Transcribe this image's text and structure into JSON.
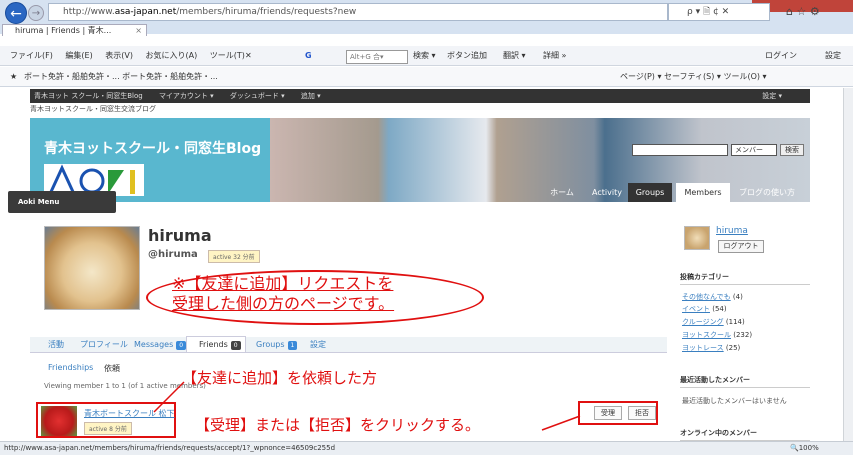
{
  "browser": {
    "url_prefix": "http://www.",
    "url_domain": "asa-japan.net",
    "url_path": "/members/hiruma/friends/requests?new",
    "addr_controls": "ρ ▾ 🗎 ¢ ✕",
    "tab_title": "hiruma | Friends | 青木...",
    "menu": [
      "ファイル(F)",
      "編集(E)",
      "表示(V)",
      "お気に入り(A)",
      "ツール(T)"
    ],
    "toolbar": {
      "google_placeholder": "Alt+G 合▾",
      "search": "検索 ▾",
      "button_add": "ボタン追加",
      "translate": "翻訳 ▾",
      "more": "詳細 »",
      "login": "ログイン",
      "settings": "設定"
    },
    "favorites": "ボート免許・船舶免許・...   ボート免許・船舶免許・...",
    "favbar_right": "ページ(P) ▾  セーフティ(S) ▾  ツール(O) ▾",
    "status_url": "http://www.asa-japan.net/members/hiruma/friends/requests/accept/1?_wpnonce=46509c255d",
    "zoom": "100%"
  },
  "site": {
    "adminbar": [
      "青木ヨット スクール・同窓生Blog",
      "マイアカウント ▾",
      "ダッシュボード ▾",
      "追加 ▾"
    ],
    "adminbar_right": "設定 ▾",
    "tagline": "青木ヨットスクール・同窓生交流ブログ",
    "title": "青木ヨットスクール・同窓生Blog",
    "search_select": "メンバー",
    "search_button": "検索",
    "nav": [
      "ホーム",
      "Activity",
      "Groups",
      "Members",
      "ブログの使い方"
    ],
    "aoki_menu": "Aoki Menu"
  },
  "profile": {
    "name": "hiruma",
    "handle": "@hiruma",
    "active": "active 32 分前",
    "callout": [
      "※【友達に追加】リクエストを",
      "受理した側の方のページです。"
    ],
    "tabs": [
      {
        "label": "活動",
        "count": null
      },
      {
        "label": "プロフィール",
        "count": null
      },
      {
        "label": "Messages",
        "count": "0"
      },
      {
        "label": "Friends",
        "count": "0"
      },
      {
        "label": "Groups",
        "count": "1"
      },
      {
        "label": "設定",
        "count": null
      }
    ],
    "sub_friendships": "Friendships",
    "sub_requests": "依頼",
    "viewing": "Viewing member 1 to 1 (of 1 active members)",
    "requester_label": "【友達に追加】を依頼した方",
    "request": {
      "name": "青木ボートスクール 松下",
      "active": "active 8 分前"
    },
    "instruction": "【受理】または【拒否】をクリックする。",
    "accept": "受理",
    "reject": "拒否"
  },
  "sidebar": {
    "user": "hiruma",
    "logout": "ログアウト",
    "cat_head": "投稿カテゴリー",
    "categories": [
      {
        "name": "その他なんでも",
        "count": "(4)"
      },
      {
        "name": "イベント",
        "count": "(54)"
      },
      {
        "name": "クルージング",
        "count": "(114)"
      },
      {
        "name": "ヨットスクール",
        "count": "(232)"
      },
      {
        "name": "ヨットレース",
        "count": "(25)"
      }
    ],
    "recent_head": "最近活動したメンバー",
    "recent_text": "最近活動したメンバーはいません",
    "online_head": "オンライン中のメンバー"
  }
}
